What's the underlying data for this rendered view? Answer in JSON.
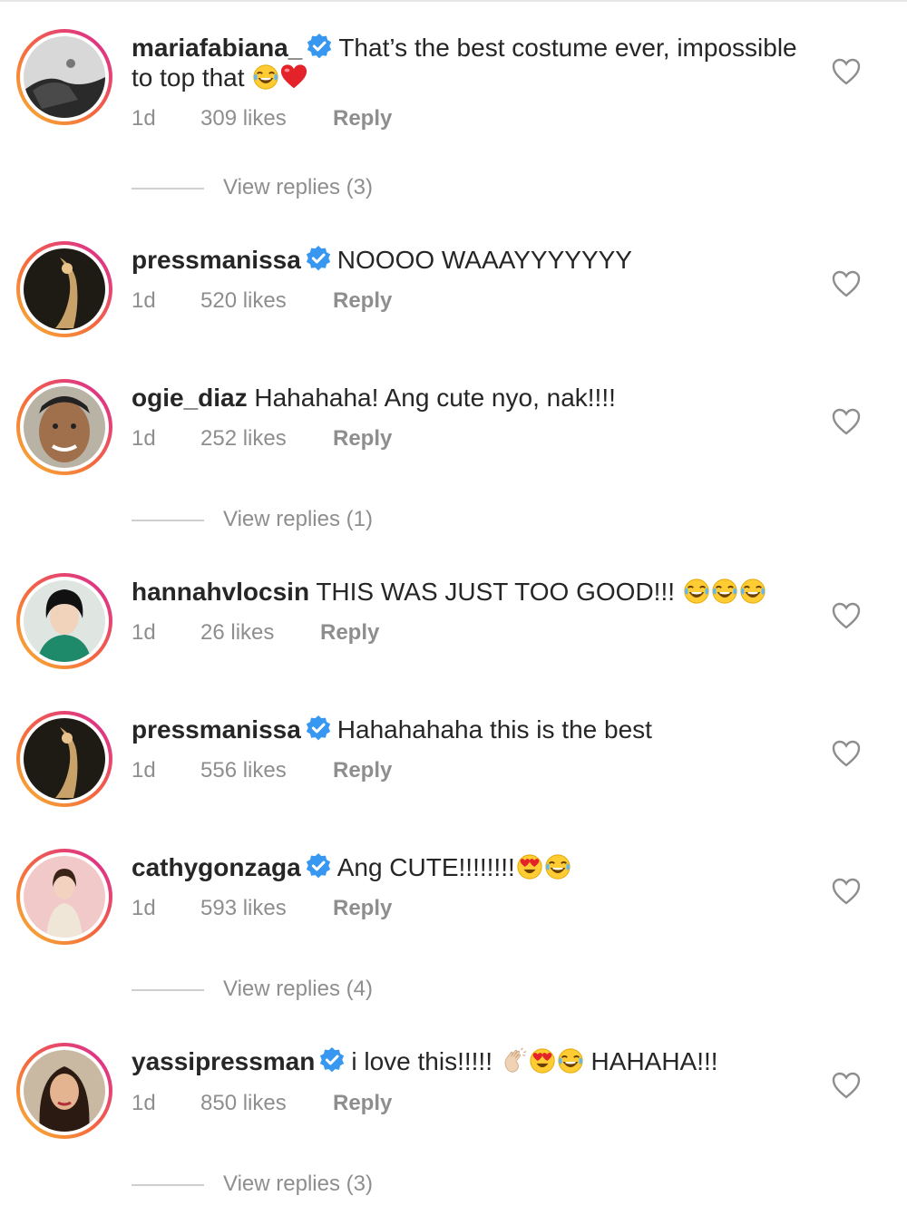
{
  "colors": {
    "text": "#262626",
    "secondary": "#8e8e8e",
    "verified": "#3897f0"
  },
  "comments": [
    {
      "username": "mariafabiana_",
      "verified": true,
      "text": "That’s the best costume ever, impossible to top that",
      "emojis": [
        "laughing-emoji",
        "red-heart-emoji"
      ],
      "time": "1d",
      "likes": "309 likes",
      "reply": "Reply"
    },
    {
      "username": "pressmanissa",
      "verified": true,
      "text": "NOOOO WAAAYYYYYYY",
      "emojis": [],
      "time": "1d",
      "likes": "520 likes",
      "reply": "Reply"
    },
    {
      "username": "ogie_diaz",
      "verified": false,
      "text": "Hahahaha! Ang cute nyo, nak!!!!",
      "emojis": [],
      "time": "1d",
      "likes": "252 likes",
      "reply": "Reply"
    },
    {
      "username": "hannahvlocsin",
      "verified": false,
      "text": "THIS WAS JUST TOO GOOD!!!",
      "emojis": [
        "laughing-emoji",
        "laughing-emoji",
        "laughing-emoji"
      ],
      "time": "1d",
      "likes": "26 likes",
      "reply": "Reply"
    },
    {
      "username": "pressmanissa",
      "verified": true,
      "text": "Hahahahaha this is the best",
      "emojis": [],
      "time": "1d",
      "likes": "556 likes",
      "reply": "Reply"
    },
    {
      "username": "cathygonzaga",
      "verified": true,
      "text": "Ang CUTE!!!!!!!!",
      "emojis": [
        "heart-eyes-emoji",
        "laughing-emoji"
      ],
      "time": "1d",
      "likes": "593 likes",
      "reply": "Reply"
    },
    {
      "username": "yassipressman",
      "verified": true,
      "text": "i love this!!!!!",
      "text_after": "HAHAHA!!!",
      "emojis": [
        "clapping-hands-emoji",
        "heart-eyes-emoji",
        "laughing-emoji"
      ],
      "time": "1d",
      "likes": "850 likes",
      "reply": "Reply"
    }
  ],
  "view_replies": [
    "View replies (3)",
    "View replies (1)",
    "View replies (4)",
    "View replies (3)"
  ]
}
